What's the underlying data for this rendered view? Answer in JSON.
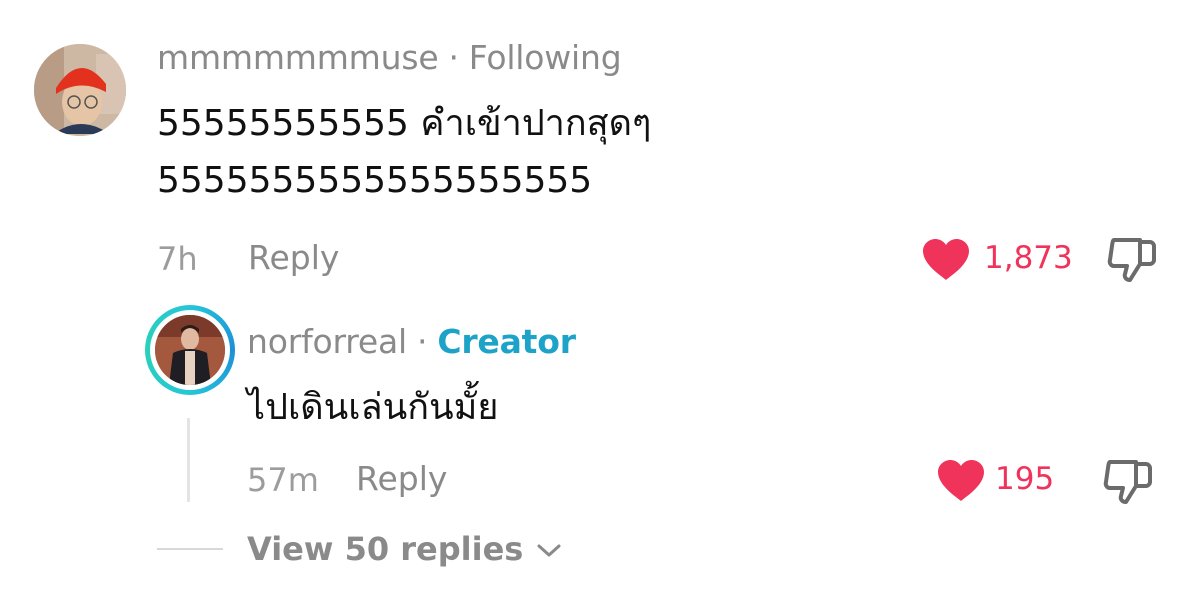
{
  "comment": {
    "username": "mmmmmmmuse",
    "separator": "·",
    "relation": "Following",
    "text_line1": "55555555555 คำเข้าปากสุดๆ",
    "text_line2": "5555555555555555555",
    "time": "7h",
    "reply_label": "Reply",
    "likes": "1,873",
    "liked": true
  },
  "reply": {
    "username": "norforreal",
    "separator": "·",
    "badge": "Creator",
    "text": "ไปเดินเล่นกันมั้ย",
    "time": "57m",
    "reply_label": "Reply",
    "likes": "195",
    "liked": true
  },
  "view_replies": {
    "label": "View 50 replies"
  },
  "colors": {
    "like_red": "#f0335a",
    "creator_blue": "#1ea3c8",
    "muted_gray": "#8a8a8a",
    "text_black": "#111111"
  },
  "icons": {
    "like": "heart-icon",
    "dislike": "thumbs-down-icon",
    "expand": "chevron-down-icon"
  }
}
